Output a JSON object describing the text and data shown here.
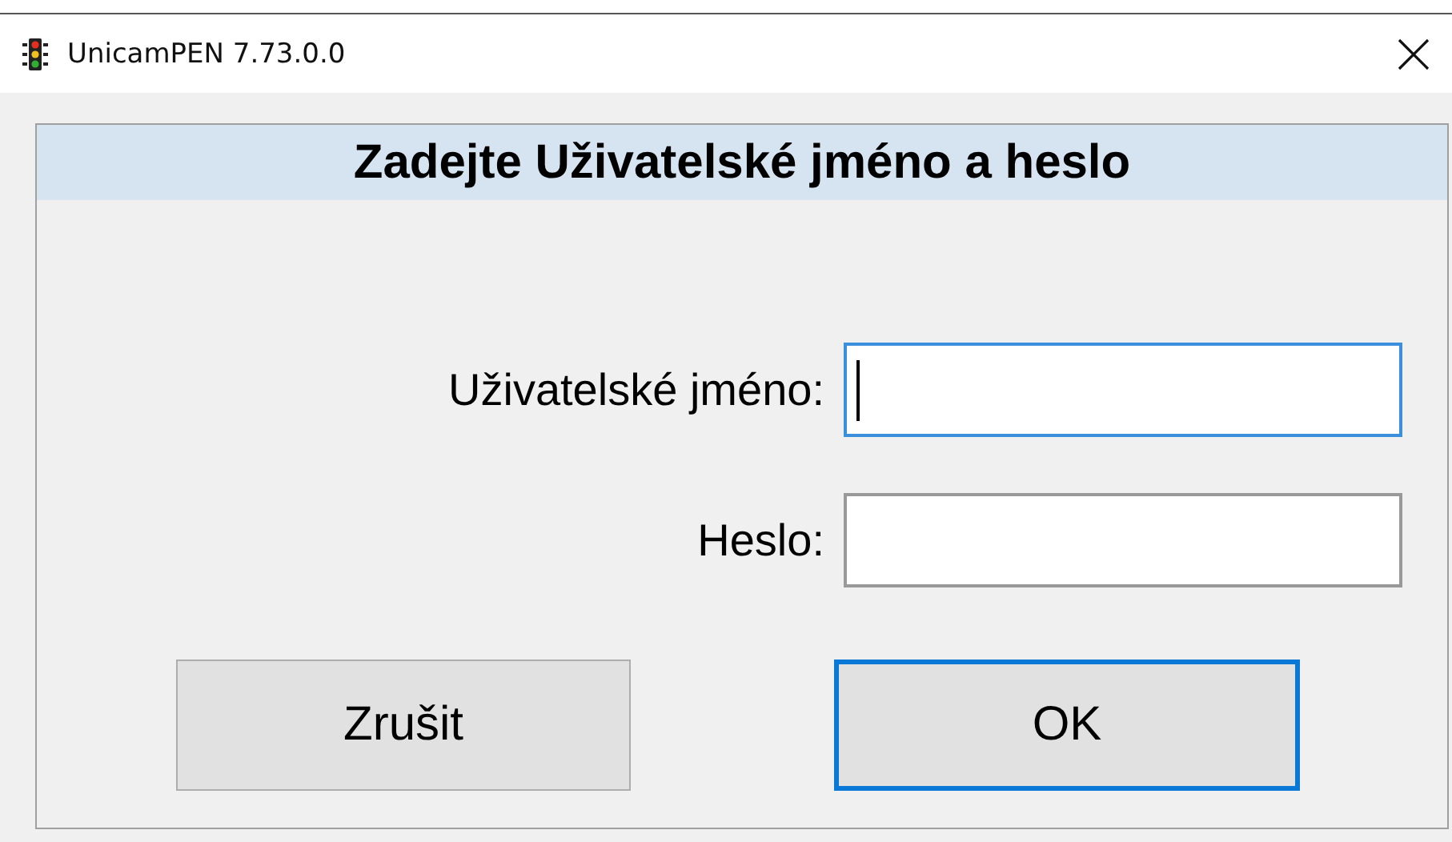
{
  "window": {
    "title": "UnicamPEN 7.73.0.0"
  },
  "heading": "Zadejte Uživatelské jméno a heslo",
  "fields": [
    {
      "label": "Uživatelské jméno:",
      "focused": true
    },
    {
      "label": "Heslo:",
      "focused": false
    }
  ],
  "buttons": [
    {
      "label": "Zrušit",
      "default": false
    },
    {
      "label": "OK",
      "default": true
    }
  ]
}
